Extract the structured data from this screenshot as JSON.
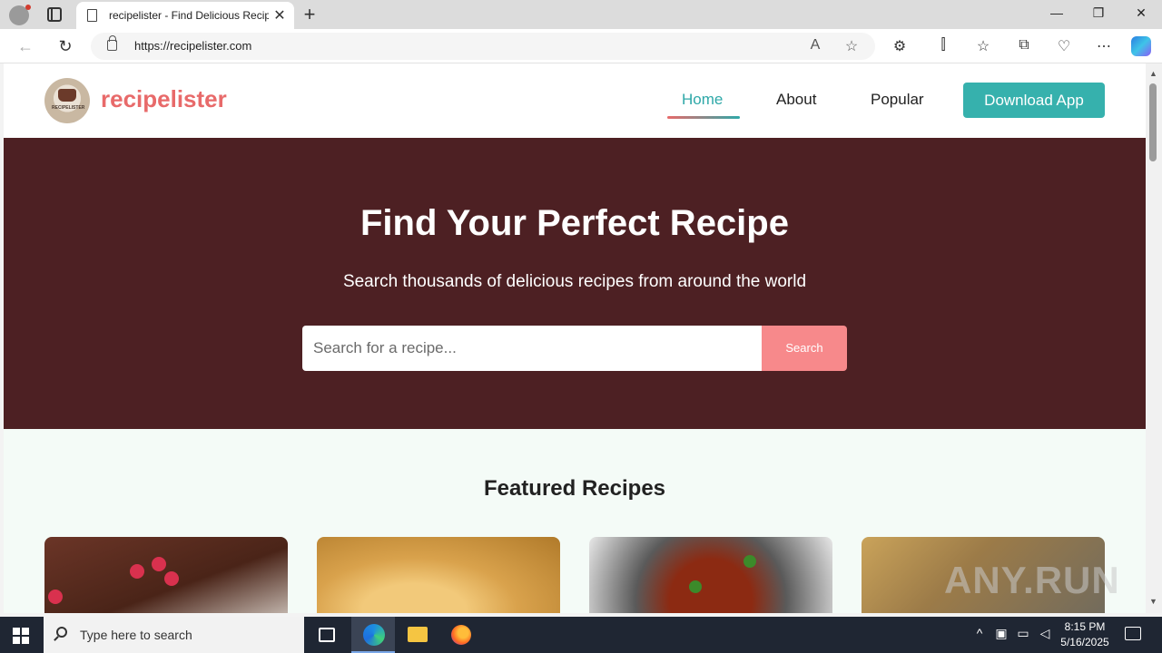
{
  "browser": {
    "tab_title": "recipelister - Find Delicious Recip",
    "tab_close": "✕",
    "new_tab": "+",
    "url": "https://recipelister.com",
    "window_controls": {
      "minimize": "—",
      "restore": "❐",
      "close": "✕"
    },
    "nav": {
      "back": "←",
      "refresh": "↻"
    },
    "url_icons": {
      "read_aloud": "A",
      "favorite": "☆"
    },
    "toolbar_icons": {
      "extensions": "⚙",
      "split": "⫿",
      "favorites": "☆",
      "collections": "⧉",
      "browser_essentials": "♡",
      "more": "⋯"
    }
  },
  "site": {
    "logo_text": "recipelister",
    "logo_badge_text": "RECIPELISTER",
    "nav": [
      {
        "label": "Home",
        "active": true
      },
      {
        "label": "About",
        "active": false
      },
      {
        "label": "Popular",
        "active": false
      }
    ],
    "download_label": "Download App",
    "hero": {
      "title": "Find Your Perfect Recipe",
      "subtitle": "Search thousands of delicious recipes from around the world",
      "search_placeholder": "Search for a recipe...",
      "search_button": "Search"
    },
    "featured_title": "Featured Recipes",
    "watermark": "ANY.RUN"
  },
  "colors": {
    "brand_coral": "#e86a6a",
    "brand_teal": "#36b1ad",
    "hero_bg": "#4d2023",
    "search_button": "#f7898b"
  },
  "taskbar": {
    "search_placeholder": "Type here to search",
    "time": "8:15 PM",
    "date": "5/16/2025",
    "tray_icons": [
      "chevron-up-icon",
      "meet-icon",
      "network-icon",
      "volume-icon"
    ]
  }
}
